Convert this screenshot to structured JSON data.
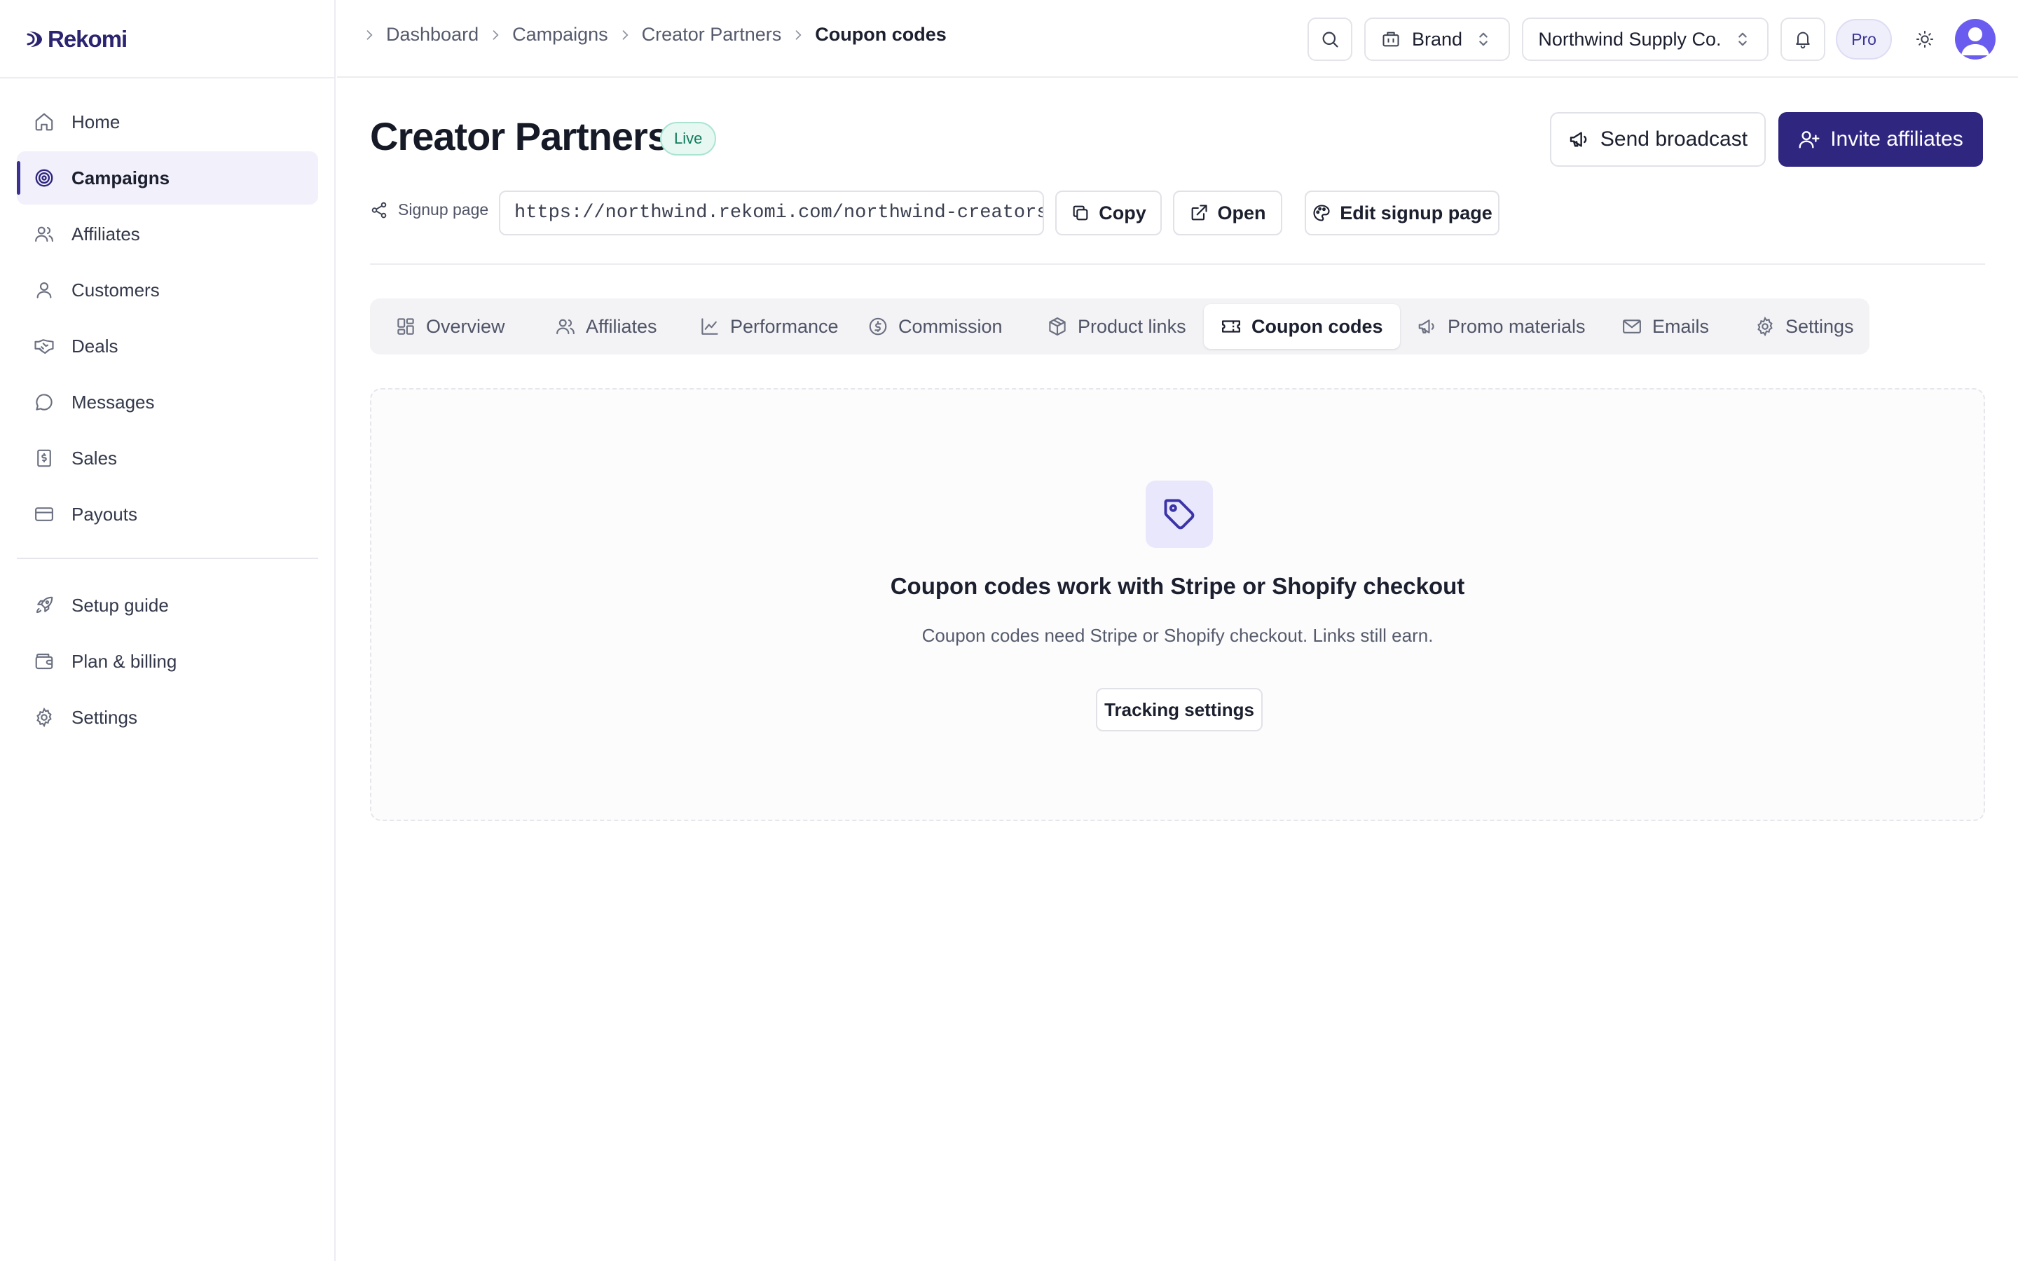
{
  "app": {
    "name": "Rekomi"
  },
  "colors": {
    "brand": "#2f2680",
    "accent_bg": "#f1f0fb",
    "live_green": "#107a5c"
  },
  "sidebar": {
    "items": [
      {
        "label": "Home",
        "icon": "home-icon",
        "active": false
      },
      {
        "label": "Campaigns",
        "icon": "target-icon",
        "active": true
      },
      {
        "label": "Affiliates",
        "icon": "users-icon",
        "active": false
      },
      {
        "label": "Customers",
        "icon": "user-icon",
        "active": false
      },
      {
        "label": "Deals",
        "icon": "handshake-icon",
        "active": false
      },
      {
        "label": "Messages",
        "icon": "message-icon",
        "active": false
      },
      {
        "label": "Sales",
        "icon": "receipt-icon",
        "active": false
      },
      {
        "label": "Payouts",
        "icon": "credit-card-icon",
        "active": false
      }
    ],
    "secondary": [
      {
        "label": "Setup guide",
        "icon": "rocket-icon"
      },
      {
        "label": "Plan & billing",
        "icon": "wallet-icon"
      },
      {
        "label": "Settings",
        "icon": "gear-icon"
      }
    ]
  },
  "header": {
    "breadcrumb": [
      "Dashboard",
      "Campaigns",
      "Creator Partners",
      "Coupon codes"
    ],
    "mode": "Brand",
    "workspace": "Northwind Supply Co.",
    "plan_badge": "Pro"
  },
  "campaign": {
    "title": "Creator Partners",
    "status": "Live",
    "send_broadcast": "Send broadcast",
    "invite_affiliates": "Invite affiliates",
    "signup_label": "Signup page",
    "signup_url": "https://northwind.rekomi.com/northwind-creators",
    "copy": "Copy",
    "open": "Open",
    "edit_signup": "Edit signup page"
  },
  "tabs": [
    {
      "label": "Overview",
      "icon": "grid-icon",
      "active": false
    },
    {
      "label": "Affiliates",
      "icon": "users-icon",
      "active": false
    },
    {
      "label": "Performance",
      "icon": "chart-line-icon",
      "active": false
    },
    {
      "label": "Commission",
      "icon": "dollar-circle-icon",
      "active": false
    },
    {
      "label": "Product links",
      "icon": "package-icon",
      "active": false
    },
    {
      "label": "Coupon codes",
      "icon": "ticket-icon",
      "active": true
    },
    {
      "label": "Promo materials",
      "icon": "megaphone-icon",
      "active": false
    },
    {
      "label": "Emails",
      "icon": "mail-icon",
      "active": false
    },
    {
      "label": "Settings",
      "icon": "gear-icon",
      "active": false
    }
  ],
  "empty_state": {
    "icon": "tag-icon",
    "title": "Coupon codes work with Stripe or Shopify checkout",
    "description": "Coupon codes need Stripe or Shopify checkout. Links still earn.",
    "button": "Tracking settings"
  }
}
